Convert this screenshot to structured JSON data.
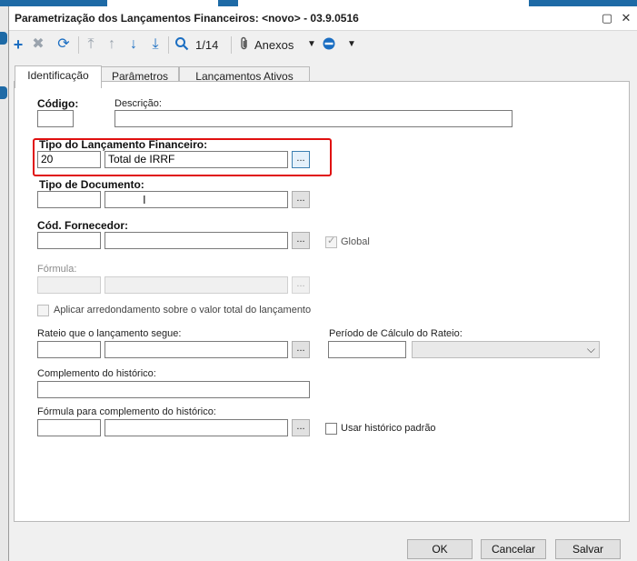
{
  "window": {
    "title": "Parametrização dos Lançamentos Financeiros: <novo> - 03.9.0516"
  },
  "toolbar": {
    "record_counter": "1/14",
    "attachments_label": "Anexos"
  },
  "tabs": [
    {
      "label": "Identificação",
      "active": true
    },
    {
      "label": "Parâmetros",
      "active": false
    },
    {
      "label": "Lançamentos Ativos",
      "active": false
    }
  ],
  "form": {
    "codigo": {
      "label": "Código:",
      "value": ""
    },
    "descricao": {
      "label": "Descrição:",
      "value": ""
    },
    "tipo_lancamento": {
      "label": "Tipo do Lançamento Financeiro:",
      "code": "20",
      "description": "Total de IRRF"
    },
    "tipo_documento": {
      "label": "Tipo de Documento:",
      "code": "",
      "description": ""
    },
    "cod_fornecedor": {
      "label": "Cód. Fornecedor:",
      "code": "",
      "description": ""
    },
    "global": {
      "label": "Global",
      "checked": true,
      "enabled": false
    },
    "formula": {
      "label": "Fórmula:",
      "code": "",
      "description": ""
    },
    "aplicar_arredondamento": {
      "label": "Aplicar arredondamento sobre o valor total do lançamento",
      "checked": false
    },
    "rateio": {
      "label": "Rateio que o lançamento segue:",
      "code": "",
      "description": ""
    },
    "periodo_calculo": {
      "label": "Período de Cálculo do Rateio:",
      "value": "",
      "selected": ""
    },
    "complemento_historico": {
      "label": "Complemento do histórico:",
      "value": ""
    },
    "formula_complemento": {
      "label": "Fórmula para complemento do histórico:",
      "code": "",
      "description": ""
    },
    "usar_historico_padrao": {
      "label": "Usar histórico padrão",
      "checked": false
    },
    "browse_label": "..."
  },
  "buttons": {
    "ok": "OK",
    "cancel": "Cancelar",
    "save": "Salvar"
  },
  "colors": {
    "accent": "#1b6ec2",
    "highlight_box": "#e01010"
  }
}
